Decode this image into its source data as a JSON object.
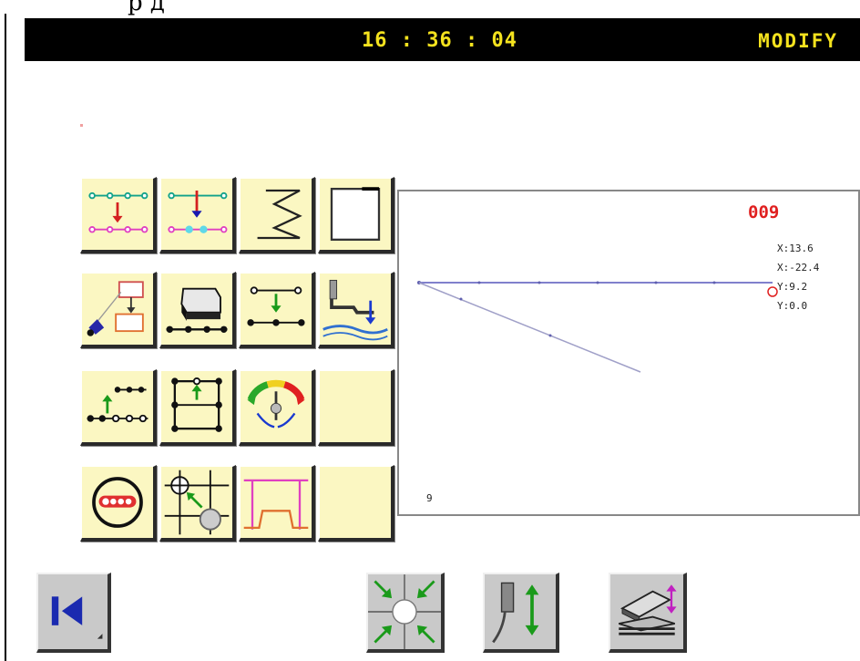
{
  "header": {
    "time": "16 : 36 : 04",
    "mode": "MODIFY"
  },
  "top_caption": "р д",
  "preview": {
    "pattern_number": "009",
    "coords": [
      "X:13.6",
      "X:-22.4",
      "Y:9.2",
      "Y:0.0"
    ],
    "pointer": "9"
  },
  "colors": {
    "button_face": "#fbf7c2",
    "header_text": "#f4e21e",
    "pattern_number": "#e02020",
    "stitch_line": "#8080cc"
  },
  "grid_buttons": [
    [
      "insert-stitch-icon",
      "insert-stitch-alt-icon",
      "zigzag-icon",
      "square-window-icon"
    ],
    [
      "move-pattern-icon",
      "eraser-icon",
      "move-point-icon",
      "presser-icon"
    ],
    [
      "add-stitch-line-icon",
      "move-frame-icon",
      "speed-gauge-icon",
      "blank"
    ],
    [
      "circle-link-icon",
      "scale-point-icon",
      "offset-icon",
      "blank"
    ]
  ],
  "bottom_buttons": [
    "back-to-start-icon",
    "center-focus-icon",
    "needle-up-down-icon",
    "presser-foot-height-icon"
  ]
}
